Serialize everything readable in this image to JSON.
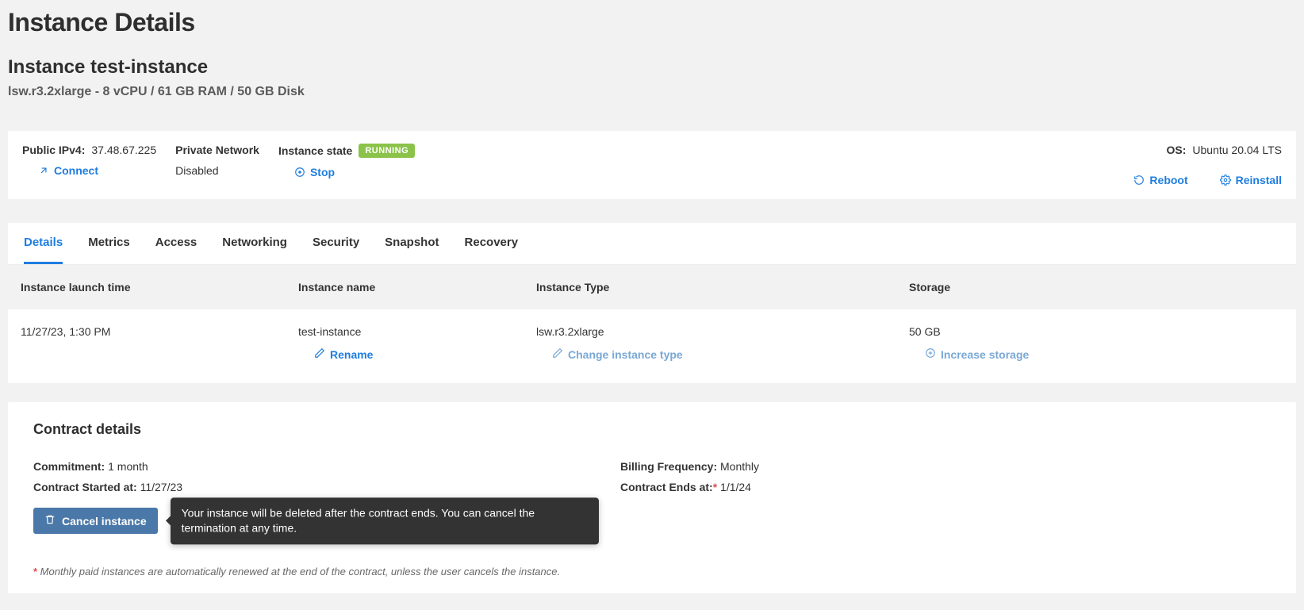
{
  "page": {
    "title": "Instance Details",
    "instance_heading_prefix": "Instance ",
    "instance_name": "test-instance",
    "specs": "lsw.r3.2xlarge - 8 vCPU / 61 GB RAM / 50 GB Disk"
  },
  "status": {
    "public_ip_label": "Public IPv4:",
    "public_ip_value": "37.48.67.225",
    "connect_label": "Connect",
    "private_network_label": "Private Network",
    "private_network_value": "Disabled",
    "state_label": "Instance state",
    "state_badge": "RUNNING",
    "stop_label": "Stop",
    "os_label": "OS:",
    "os_value": "Ubuntu 20.04 LTS",
    "reboot_label": "Reboot",
    "reinstall_label": "Reinstall"
  },
  "tabs": [
    {
      "label": "Details",
      "active": true
    },
    {
      "label": "Metrics",
      "active": false
    },
    {
      "label": "Access",
      "active": false
    },
    {
      "label": "Networking",
      "active": false
    },
    {
      "label": "Security",
      "active": false
    },
    {
      "label": "Snapshot",
      "active": false
    },
    {
      "label": "Recovery",
      "active": false
    }
  ],
  "details": {
    "headers": {
      "launch_time": "Instance launch time",
      "name": "Instance name",
      "type": "Instance Type",
      "storage": "Storage"
    },
    "values": {
      "launch_time": "11/27/23, 1:30 PM",
      "name": "test-instance",
      "type": "lsw.r3.2xlarge",
      "storage": "50 GB"
    },
    "actions": {
      "rename": "Rename",
      "change_type": "Change instance type",
      "increase_storage": "Increase storage"
    }
  },
  "contract": {
    "title": "Contract details",
    "commitment_label": "Commitment:",
    "commitment_value": "1 month",
    "billing_label": "Billing Frequency:",
    "billing_value": "Monthly",
    "started_label": "Contract Started at:",
    "started_value": "11/27/23",
    "ends_label": "Contract Ends at:",
    "ends_value": "1/1/24",
    "cancel_button": "Cancel instance",
    "tooltip": "Your instance will be deleted after the contract ends. You can cancel the termination at any time.",
    "footnote": "Monthly paid instances are automatically renewed at the end of the contract, unless the user cancels the instance."
  }
}
